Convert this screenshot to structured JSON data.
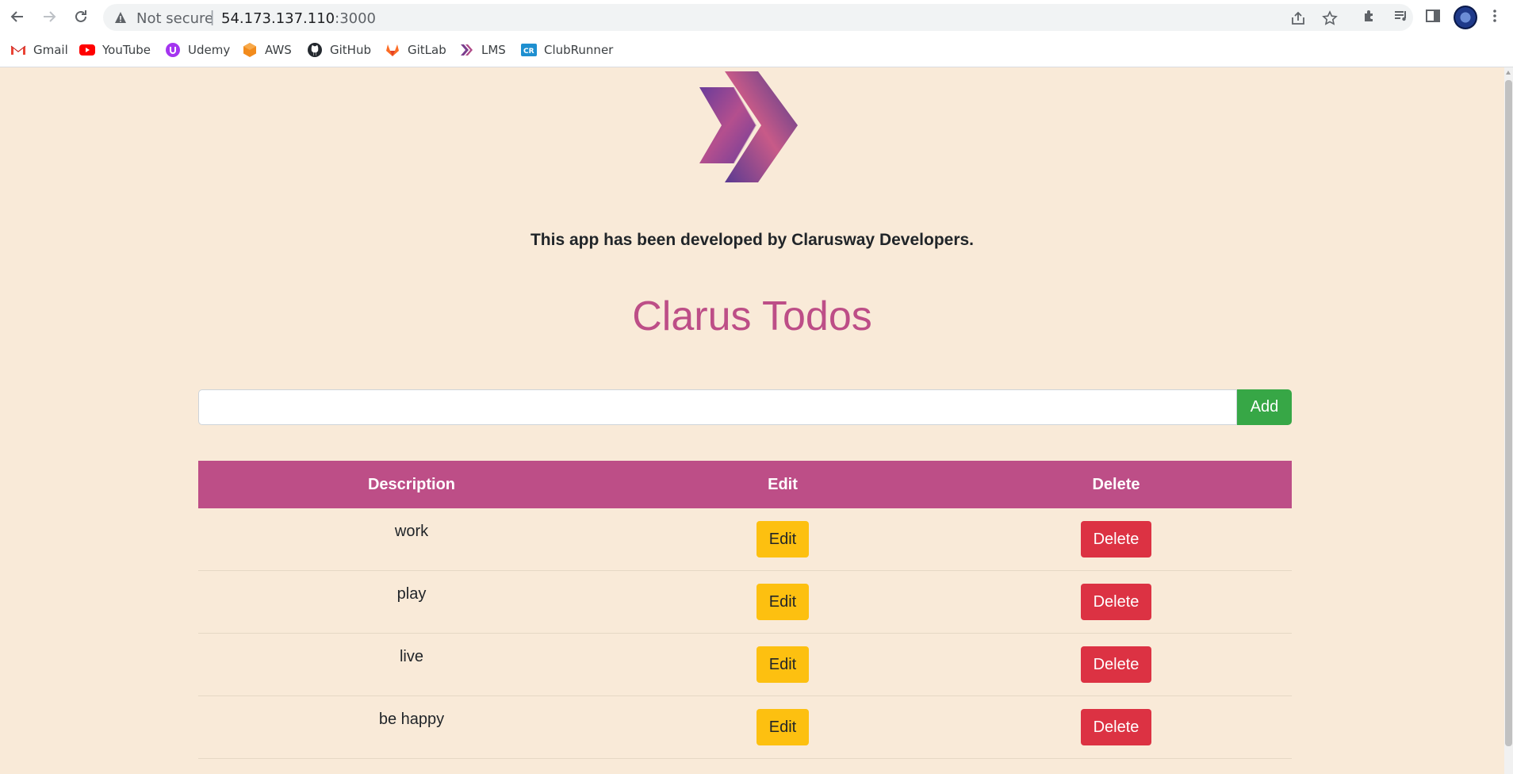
{
  "browser": {
    "security_text": "Not secure",
    "separator": "|",
    "url_host": "54.173.137.110",
    "url_port": ":3000"
  },
  "bookmarks": [
    {
      "label": "Gmail",
      "icon": "gmail-icon"
    },
    {
      "label": "YouTube",
      "icon": "youtube-icon"
    },
    {
      "label": "Udemy",
      "icon": "udemy-icon"
    },
    {
      "label": "AWS",
      "icon": "aws-icon"
    },
    {
      "label": "GitHub",
      "icon": "github-icon"
    },
    {
      "label": "GitLab",
      "icon": "gitlab-icon"
    },
    {
      "label": "LMS",
      "icon": "lms-icon"
    },
    {
      "label": "ClubRunner",
      "icon": "clubrunner-icon"
    }
  ],
  "app": {
    "credit": "This app has been developed by Clarusway Developers.",
    "title": "Clarus Todos",
    "input_value": "",
    "add_label": "Add",
    "headers": {
      "description": "Description",
      "edit": "Edit",
      "delete": "Delete"
    },
    "todos": [
      {
        "description": "work",
        "edit": "Edit",
        "delete": "Delete"
      },
      {
        "description": "play",
        "edit": "Edit",
        "delete": "Delete"
      },
      {
        "description": "live",
        "edit": "Edit",
        "delete": "Delete"
      },
      {
        "description": "be happy",
        "edit": "Edit",
        "delete": "Delete"
      }
    ]
  },
  "colors": {
    "page_bg": "#f9ead8",
    "accent": "#bd4e87",
    "add": "#37a746",
    "edit": "#fdc010",
    "delete": "#dc3243"
  }
}
